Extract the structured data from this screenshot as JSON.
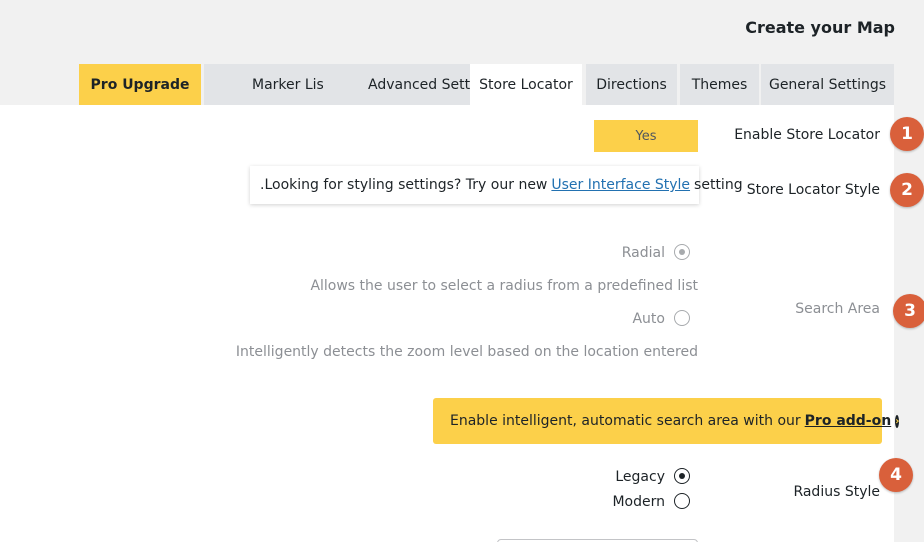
{
  "page": {
    "title": "Create your Map"
  },
  "tabs": [
    {
      "label": "Pro Upgrade"
    },
    {
      "label": "Marker Listing"
    },
    {
      "label": "Advanced Settings"
    },
    {
      "label": "Store Locator"
    },
    {
      "label": "Directions"
    },
    {
      "label": "Themes"
    },
    {
      "label": "General Settings"
    }
  ],
  "settings": {
    "enable_store_locator": {
      "label": "Enable Store Locator",
      "value": "Yes",
      "badge": "1"
    },
    "store_locator_style": {
      "label": "Store Locator Style",
      "badge": "2",
      "notice_prefix": ".Looking for styling settings? Try our new",
      "notice_link": "User Interface Style",
      "notice_suffix": "setting"
    },
    "search_area": {
      "label": "Search Area",
      "badge": "3",
      "options": [
        {
          "label": "Radial",
          "description": "Allows the user to select a radius from a predefined list",
          "selected": true
        },
        {
          "label": "Auto",
          "description": "Intelligently detects the zoom level based on the location entered",
          "selected": false
        }
      ],
      "pro_text": "Enable intelligent, automatic search area with our",
      "pro_link": "Pro add-on"
    },
    "radius_style": {
      "label": "Radius Style",
      "badge": "4",
      "options": [
        {
          "label": "Legacy",
          "selected": true
        },
        {
          "label": "Modern",
          "selected": false
        }
      ]
    }
  },
  "colors": {
    "accent": "#fcd04a",
    "badge": "#d9603b",
    "link": "#2271b1"
  },
  "icons": {
    "pro_link_icon": "arrow-circle-right-icon"
  }
}
